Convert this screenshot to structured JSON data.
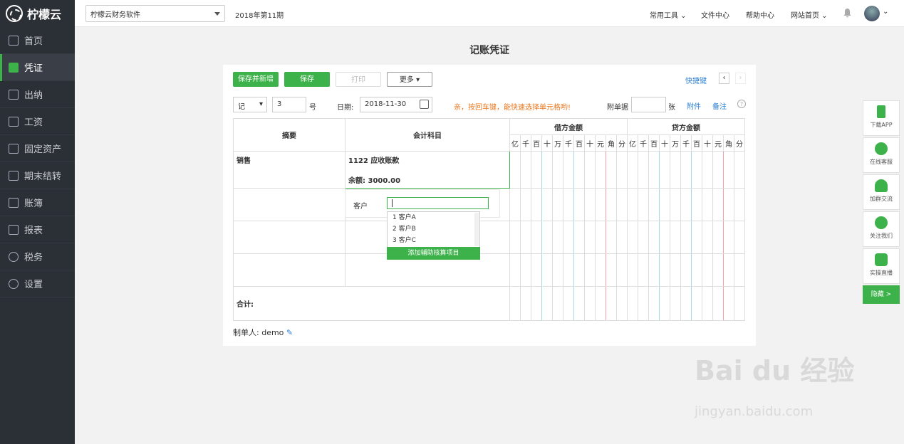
{
  "app": {
    "logo_text": "柠檬云"
  },
  "nav": [
    {
      "label": "首页",
      "icon": "home-icon"
    },
    {
      "label": "凭证",
      "icon": "voucher-icon",
      "active": true
    },
    {
      "label": "出纳",
      "icon": "cashier-icon"
    },
    {
      "label": "工资",
      "icon": "salary-icon"
    },
    {
      "label": "固定资产",
      "icon": "asset-icon"
    },
    {
      "label": "期末结转",
      "icon": "calendar-icon"
    },
    {
      "label": "账簿",
      "icon": "ledger-icon"
    },
    {
      "label": "报表",
      "icon": "chart-icon"
    },
    {
      "label": "税务",
      "icon": "tax-icon"
    },
    {
      "label": "设置",
      "icon": "gear-icon"
    }
  ],
  "topbar": {
    "company": "柠檬云财务软件",
    "period": "2018年第11期",
    "tools": "常用工具",
    "files": "文件中心",
    "help": "帮助中心",
    "home": "网站首页"
  },
  "page": {
    "title": "记账凭证"
  },
  "toolbar": {
    "save_new": "保存并新增",
    "save": "保存",
    "print": "打印",
    "more": "更多",
    "shortcut": "快捷键"
  },
  "form": {
    "voucher_type": "记",
    "voucher_no": "3",
    "no_suffix": "号",
    "date_label": "日期:",
    "date": "2018-11-30",
    "hint": "亲，按回车键，能快速选择单元格哟!",
    "attach_label": "附单据",
    "attach_unit": "张",
    "attachment": "附件",
    "remark": "备注"
  },
  "table": {
    "col_summary": "摘要",
    "col_account": "会计科目",
    "col_debit": "借方金额",
    "col_credit": "贷方金额",
    "digits": [
      "亿",
      "千",
      "百",
      "十",
      "万",
      "千",
      "百",
      "十",
      "元",
      "角",
      "分"
    ],
    "row1_summary": "销售",
    "row1_account": "1122 应收账款",
    "row1_balance_label": "余额:",
    "row1_balance": "3000.00",
    "total_label": "合计:"
  },
  "dropdown": {
    "label": "客户",
    "items": [
      "1 客户A",
      "2 客户B",
      "3 客户C"
    ],
    "add": "添加辅助核算项目"
  },
  "footer": {
    "creator_label": "制单人:",
    "creator": "demo"
  },
  "rightbar": [
    {
      "label": "下载APP"
    },
    {
      "label": "在线客服"
    },
    {
      "label": "加群交流"
    },
    {
      "label": "关注我们"
    },
    {
      "label": "实操直播"
    }
  ],
  "rightbar_hide": "隐藏 >",
  "watermark": {
    "brand": "Bai du 经验",
    "url": "jingyan.baidu.com"
  },
  "colors": {
    "accent": "#3db14a",
    "hint": "#e8771e",
    "link": "#2a7fd4"
  }
}
